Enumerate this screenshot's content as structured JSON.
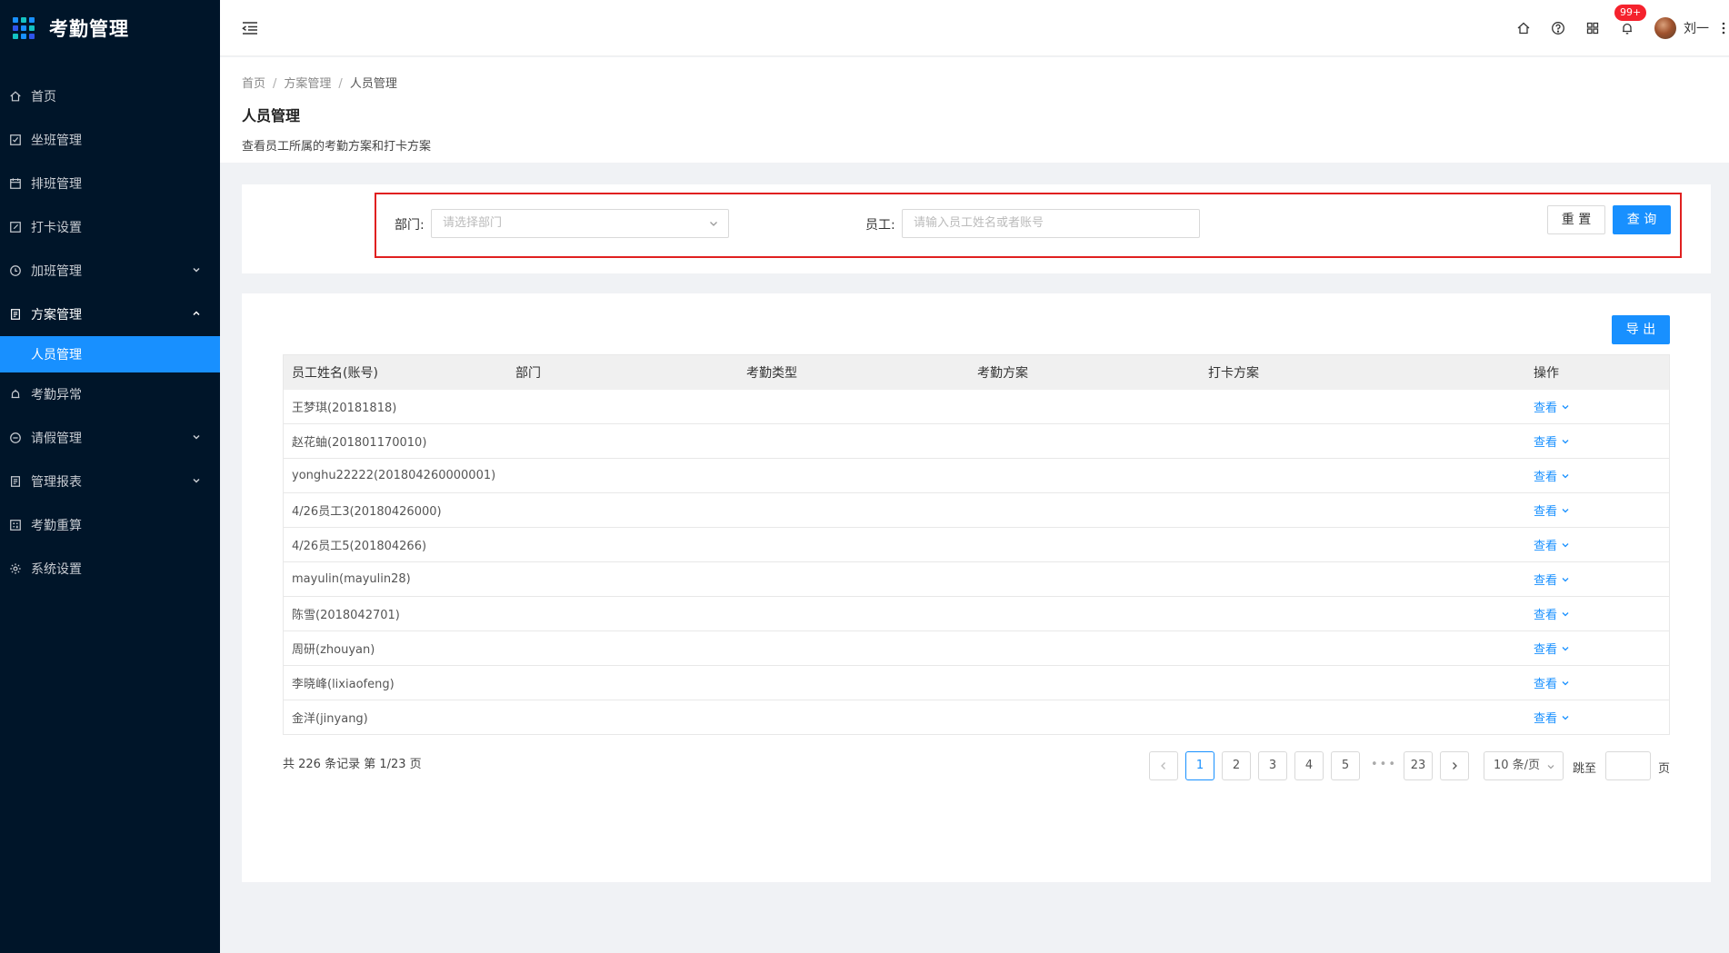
{
  "app": {
    "title": "考勤管理"
  },
  "sidebar": {
    "items": [
      {
        "label": "首页",
        "icon": "home-icon"
      },
      {
        "label": "坐班管理",
        "icon": "checkbox-icon"
      },
      {
        "label": "排班管理",
        "icon": "calendar-icon"
      },
      {
        "label": "打卡设置",
        "icon": "edit-icon"
      },
      {
        "label": "加班管理",
        "icon": "clock-icon",
        "expandable": true
      },
      {
        "label": "方案管理",
        "icon": "document-icon",
        "expanded": true
      },
      {
        "label": "考勤异常",
        "icon": "alarm-icon"
      },
      {
        "label": "请假管理",
        "icon": "minus-circle-icon",
        "expandable": true
      },
      {
        "label": "管理报表",
        "icon": "report-icon",
        "expandable": true
      },
      {
        "label": "考勤重算",
        "icon": "calculator-icon"
      },
      {
        "label": "系统设置",
        "icon": "gear-icon"
      }
    ],
    "sub_items": [
      {
        "label": "人员管理",
        "active": true
      }
    ]
  },
  "header": {
    "notification_badge": "99+",
    "username": "刘一"
  },
  "breadcrumb": {
    "items": [
      "首页",
      "方案管理",
      "人员管理"
    ],
    "separator": "/"
  },
  "page": {
    "title": "人员管理",
    "description": "查看员工所属的考勤方案和打卡方案"
  },
  "search": {
    "dept_label": "部门:",
    "dept_placeholder": "请选择部门",
    "employee_label": "员工:",
    "employee_placeholder": "请输入员工姓名或者账号",
    "reset_label": "重 置",
    "query_label": "查 询"
  },
  "table": {
    "export_label": "导 出",
    "columns": [
      "员工姓名(账号)",
      "部门",
      "考勤类型",
      "考勤方案",
      "打卡方案",
      "操作"
    ],
    "action_label": "查看",
    "rows": [
      {
        "name": "王梦琪(20181818)"
      },
      {
        "name": "赵花蚰(201801170010)"
      },
      {
        "name": "yonghu22222(201804260000001)"
      },
      {
        "name": "4/26员工3(20180426000)"
      },
      {
        "name": "4/26员工5(201804266)"
      },
      {
        "name": "mayulin(mayulin28)"
      },
      {
        "name": "陈雪(2018042701)"
      },
      {
        "name": "周研(zhouyan)"
      },
      {
        "name": "李晓峰(lixiaofeng)"
      },
      {
        "name": "金洋(jinyang)"
      }
    ]
  },
  "pagination": {
    "total_text": "共 226 条记录 第 1/23 页",
    "pages": [
      "1",
      "2",
      "3",
      "4",
      "5"
    ],
    "ellipsis": "•••",
    "last_page": "23",
    "current_page": 1,
    "page_size": "10 条/页",
    "jump_label": "跳至",
    "page_suffix": "页"
  },
  "colors": {
    "sidebar_bg": "#001529",
    "accent": "#1890ff",
    "highlight_border": "#e02020",
    "badge": "#f5222d"
  }
}
